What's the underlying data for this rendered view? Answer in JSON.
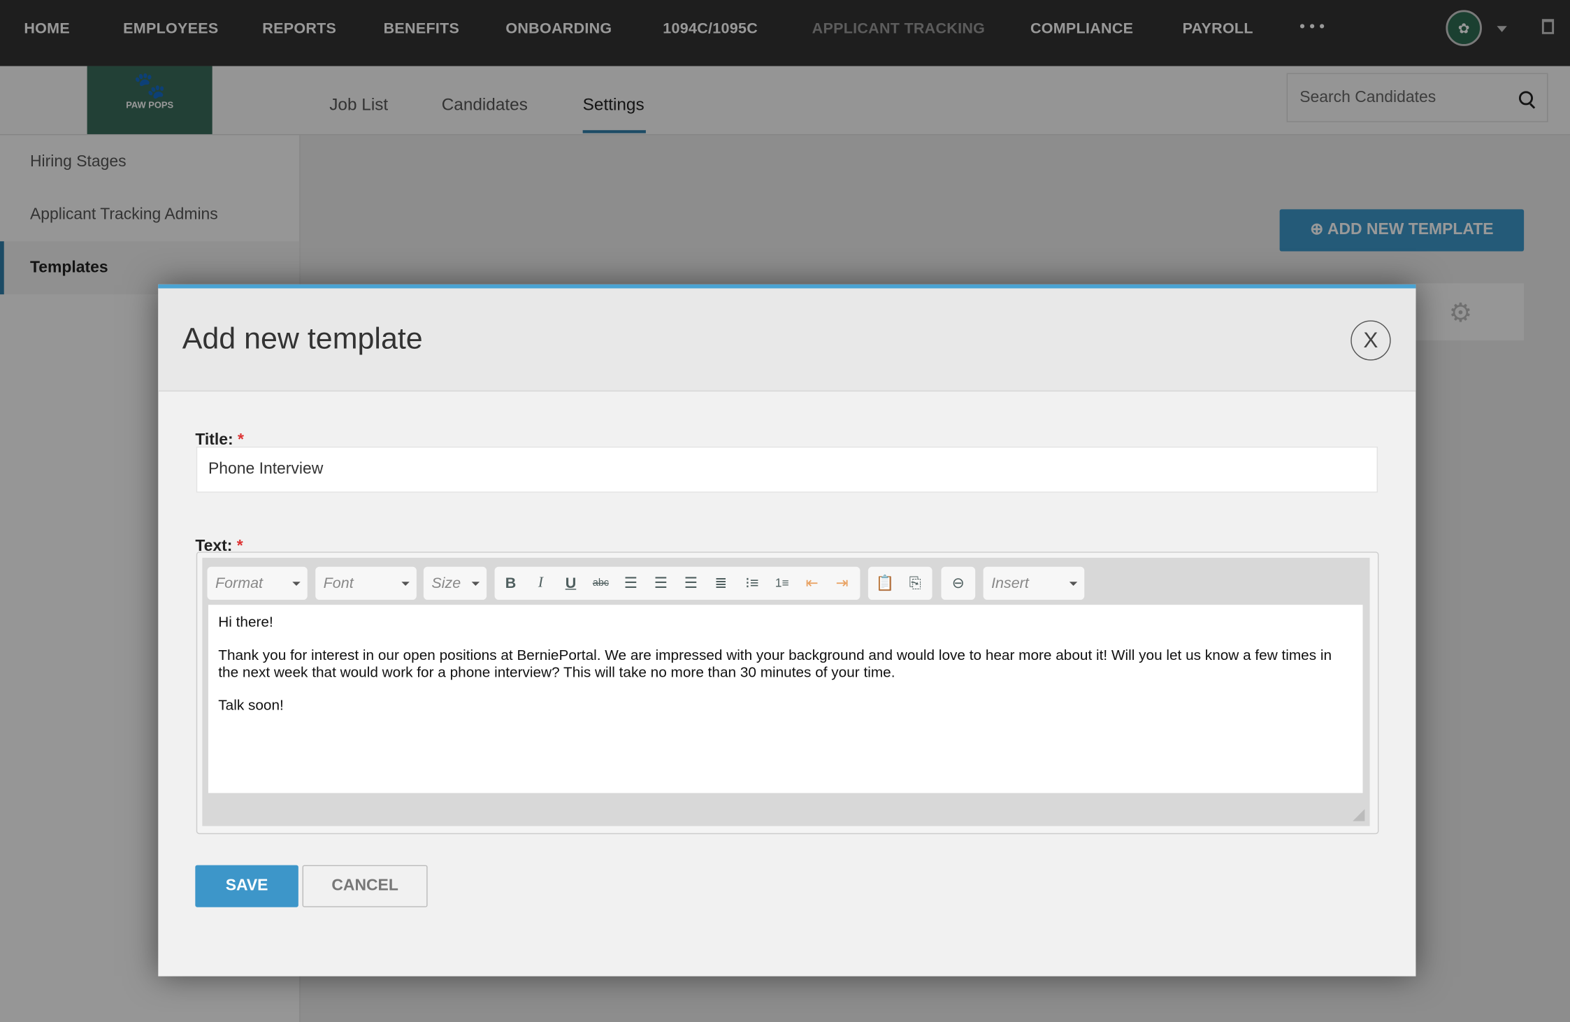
{
  "nav": {
    "items": [
      "HOME",
      "EMPLOYEES",
      "REPORTS",
      "BENEFITS",
      "ONBOARDING",
      "1094C/1095C",
      "APPLICANT TRACKING",
      "COMPLIANCE",
      "PAYROLL"
    ],
    "more": "• • •"
  },
  "logo": {
    "text": "PAW POPS"
  },
  "tabs": [
    "Job List",
    "Candidates",
    "Settings"
  ],
  "active_tab": "Settings",
  "search": {
    "placeholder": "Search Candidates"
  },
  "sidebar": {
    "items": [
      "Hiring Stages",
      "Applicant Tracking Admins",
      "Templates"
    ],
    "active": "Templates"
  },
  "main": {
    "add_button": "ADD NEW TEMPLATE"
  },
  "modal": {
    "title": "Add new template",
    "close": "X",
    "title_label": "Title:",
    "text_label": "Text:",
    "required": "*",
    "title_value": "Phone Interview",
    "toolbar": {
      "format": "Format",
      "font": "Font",
      "size": "Size",
      "insert": "Insert"
    },
    "body": [
      "Hi there!",
      "Thank you for interest in our open positions at BerniePortal. We are impressed with your background and would love to hear more about it! Will you let us know a few times in the next week that would work for a phone interview? This will take no more than 30 minutes of your time.",
      "Talk soon!"
    ],
    "save": "SAVE",
    "cancel": "CANCEL"
  },
  "colors": {
    "accent": "#3d96c9",
    "nav_bg": "#333333",
    "logo_bg": "#3a6b5a",
    "modal_top": "#4aa3d3"
  }
}
